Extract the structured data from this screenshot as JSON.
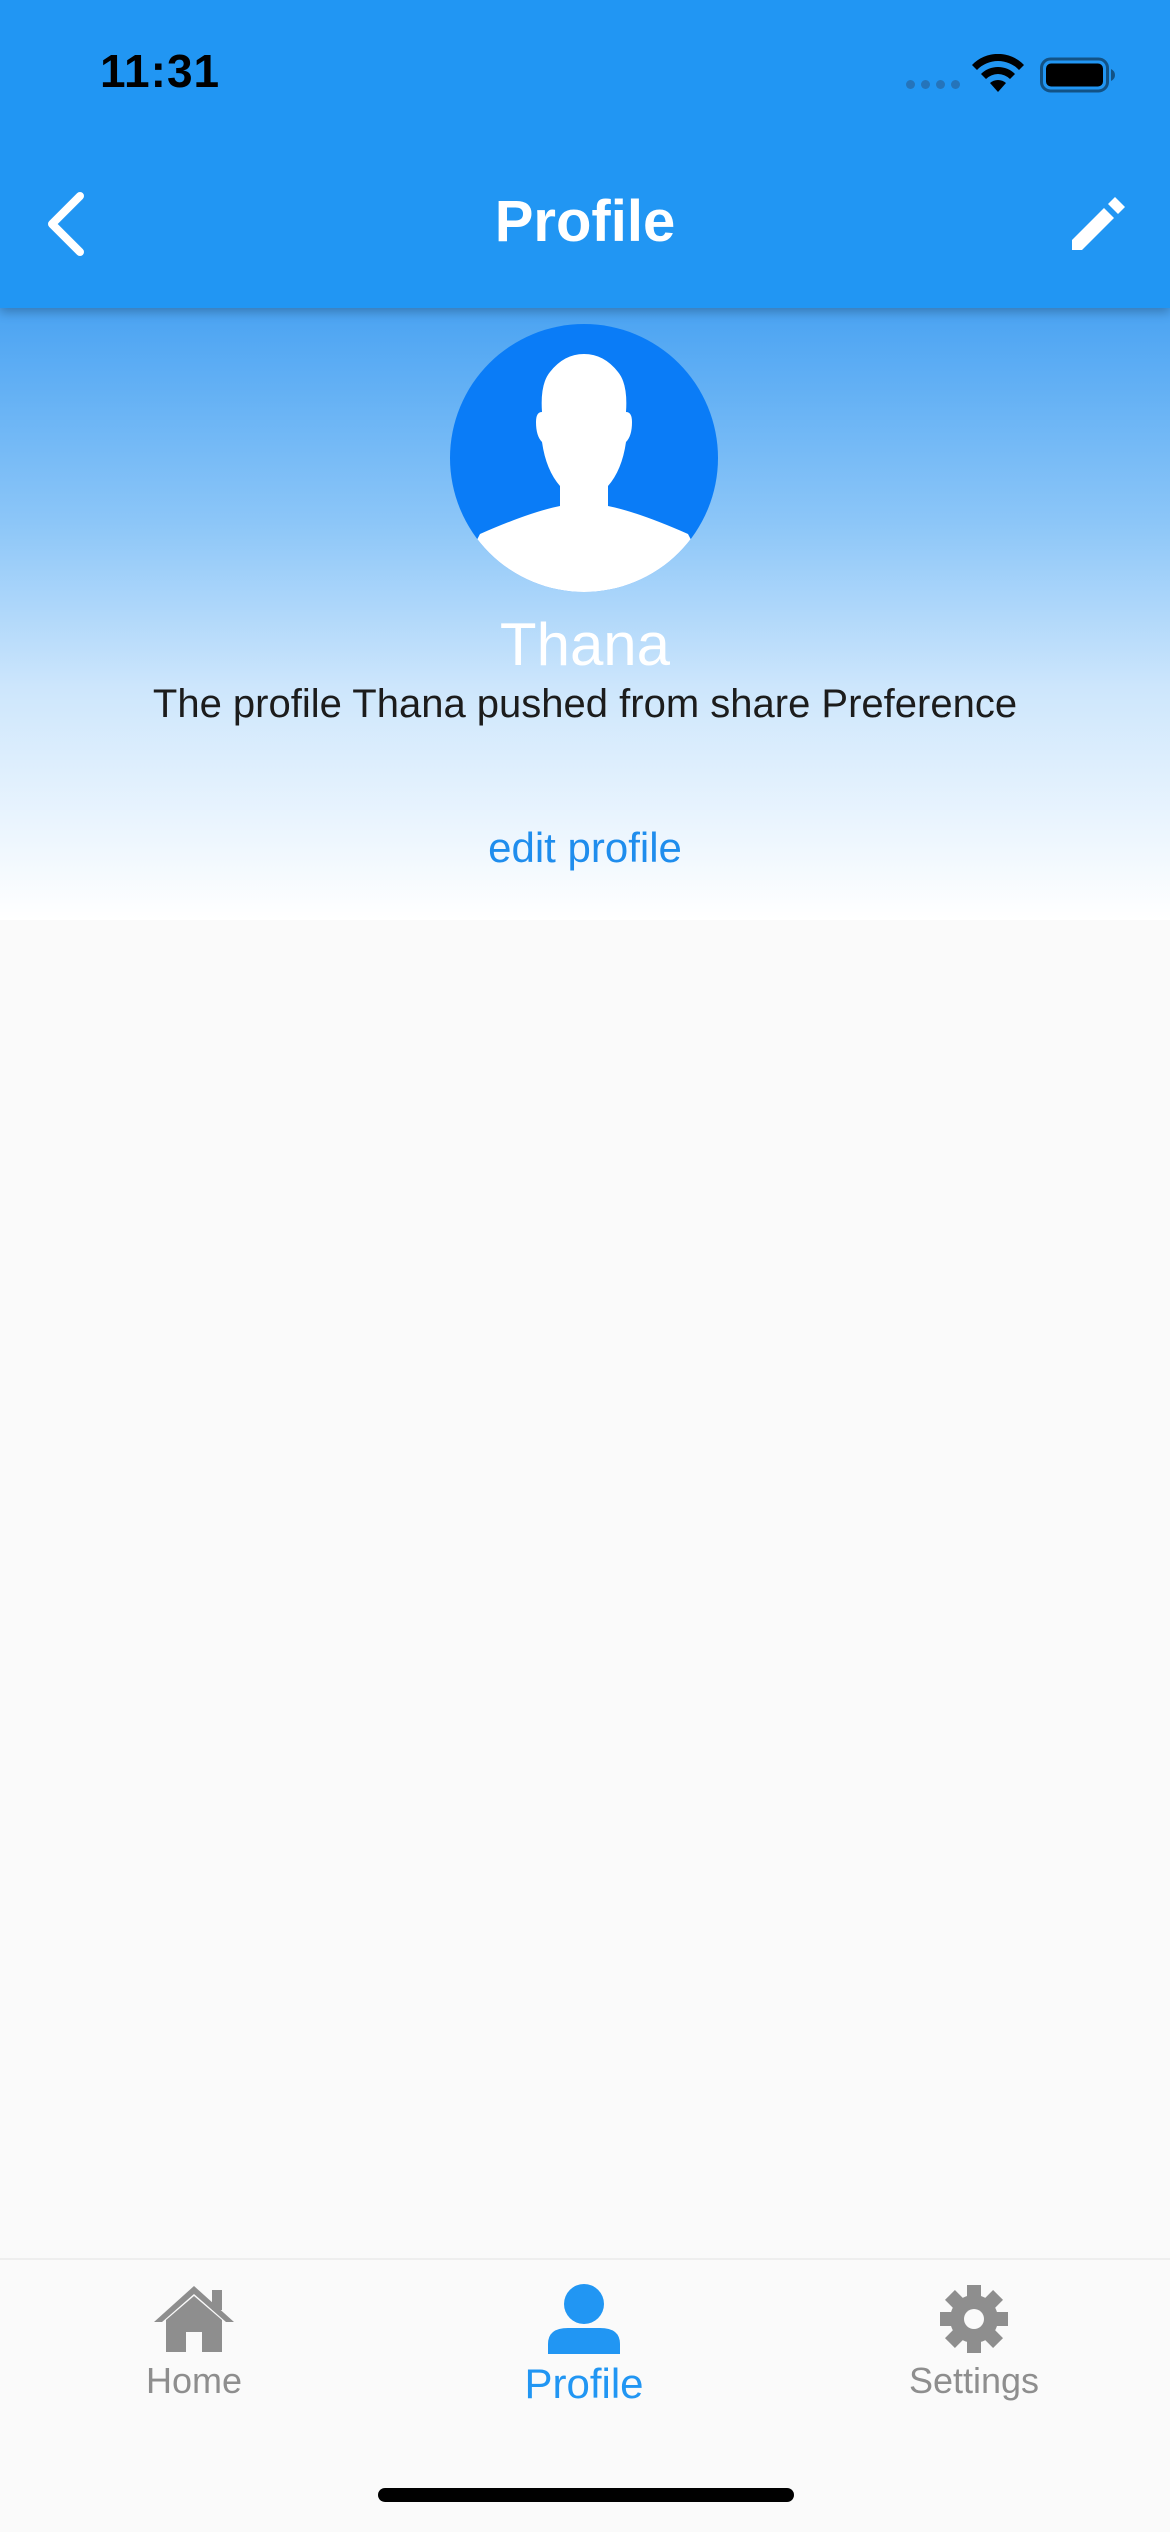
{
  "status_bar": {
    "time": "11:31"
  },
  "app_bar": {
    "title": "Profile",
    "back_icon": "chevron-left-icon",
    "edit_icon": "pencil-icon",
    "background_color": "#2196f3"
  },
  "profile": {
    "name": "Thana",
    "bio": "The profile Thana pushed from share Preference",
    "edit_link": "edit profile",
    "avatar_icon": "person-silhouette-icon",
    "avatar_color": "#0a7cf7"
  },
  "bottom_nav": {
    "items": [
      {
        "label": "Home",
        "icon": "home-icon",
        "active": false
      },
      {
        "label": "Profile",
        "icon": "person-icon",
        "active": true
      },
      {
        "label": "Settings",
        "icon": "gear-icon",
        "active": false
      }
    ],
    "active_color": "#2196f3",
    "inactive_color": "#8e8e8e"
  }
}
